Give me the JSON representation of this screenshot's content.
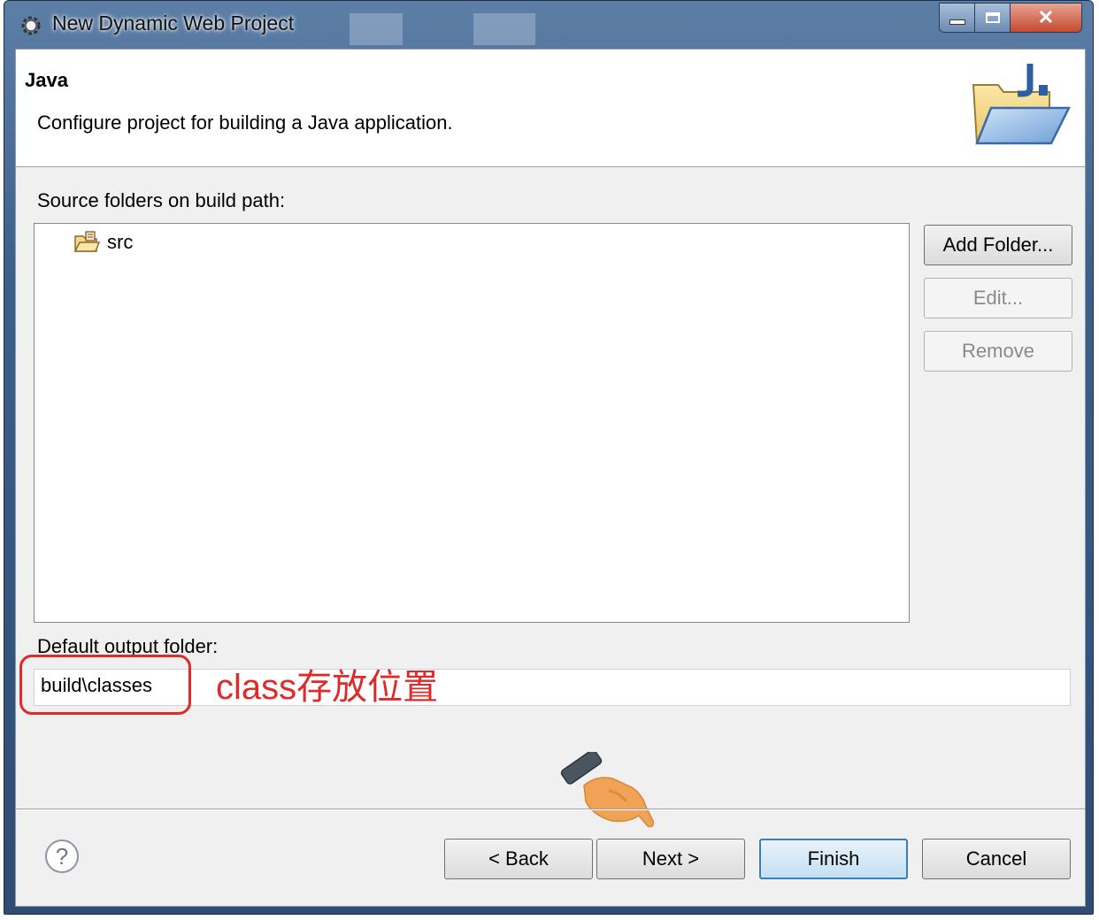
{
  "window": {
    "title": "New Dynamic Web Project",
    "close_symbol": "✕",
    "app_icon": "eclipse-gear-icon"
  },
  "header": {
    "title": "Java",
    "description": "Configure project for building a Java application.",
    "icon": "java-folder-banner-icon"
  },
  "source_section": {
    "label": "Source folders on build path:",
    "items": [
      {
        "label": "src",
        "icon": "source-package-folder-icon"
      }
    ],
    "buttons": {
      "add_folder": "Add Folder...",
      "edit": "Edit...",
      "remove": "Remove"
    }
  },
  "output": {
    "label": "Default output folder:",
    "value": "build\\classes"
  },
  "annotation": {
    "text": "class存放位置",
    "color": "#e02a2a"
  },
  "footer": {
    "help_icon": "help-icon",
    "back": "< Back",
    "next": "Next >",
    "finish": "Finish",
    "cancel": "Cancel",
    "pointer_icon": "pointing-hand-icon"
  }
}
